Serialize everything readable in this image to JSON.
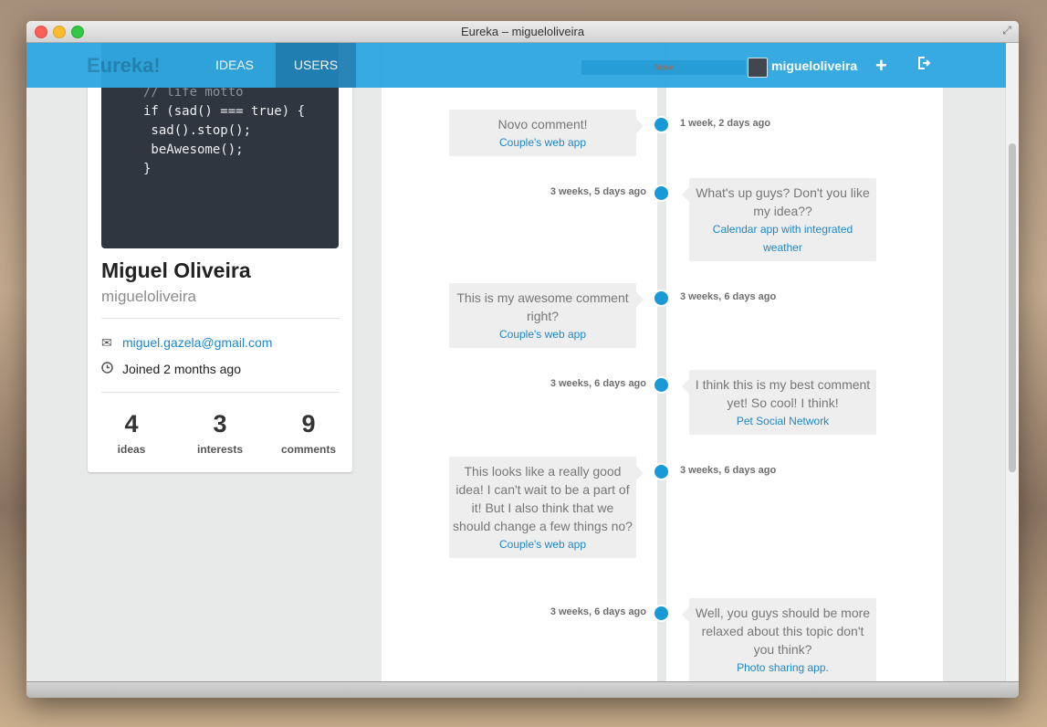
{
  "window": {
    "title": "Eureka – migueloliveira"
  },
  "nav": {
    "brand": "Eureka!",
    "ideas": "IDEAS",
    "users": "USERS",
    "search_placeholder": "Now",
    "username": "migueloliveira",
    "add_icon": "plus-icon",
    "signout_icon": "sign-out-icon"
  },
  "profile": {
    "cover_code": [
      "// life motto",
      "if (sad() === true) {",
      " sad().stop();",
      " beAwesome();",
      "}"
    ],
    "name": "Miguel Oliveira",
    "username": "migueloliveira",
    "email": "miguel.gazela@gmail.com",
    "joined": "Joined 2 months ago",
    "stats": [
      {
        "value": "4",
        "label": "ideas"
      },
      {
        "value": "3",
        "label": "interests"
      },
      {
        "value": "9",
        "label": "comments"
      }
    ]
  },
  "timeline": [
    {
      "side": "left",
      "text": "Novo comment!",
      "idea": "Couple's web app",
      "time": "1 week, 2 days ago"
    },
    {
      "side": "right",
      "text": "What's up guys? Don't you like my idea??",
      "idea": "Calendar app with integrated weather",
      "time": "3 weeks, 5 days ago"
    },
    {
      "side": "left",
      "text": "This is my awesome comment right?",
      "idea": "Couple's web app",
      "time": "3 weeks, 6 days ago"
    },
    {
      "side": "right",
      "text": "I think this is my best comment yet! So cool! I think!",
      "idea": "Pet Social Network",
      "time": "3 weeks, 6 days ago"
    },
    {
      "side": "left",
      "text": "This looks like a really good idea! I can't wait to be a part of it! But I also think that we should change a few things no?",
      "idea": "Couple's web app",
      "time": "3 weeks, 6 days ago"
    },
    {
      "side": "right",
      "text": "Well, you guys should be more relaxed about this topic don't you think?",
      "idea": "Photo sharing app.",
      "time": "3 weeks, 6 days ago"
    }
  ],
  "colors": {
    "accent": "#2fa7e0",
    "timeline_dot": "#199ad6",
    "link": "#1e88c7"
  }
}
